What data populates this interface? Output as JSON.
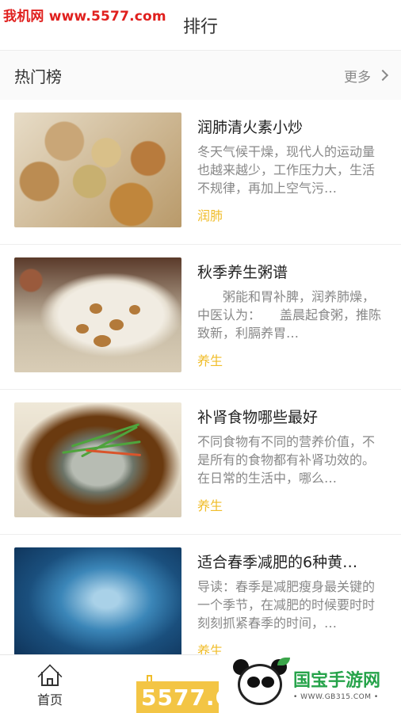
{
  "watermark_top": "我机网 www.5577.com",
  "header": {
    "title": "排行"
  },
  "section": {
    "title": "热门榜",
    "more_label": "更多"
  },
  "items": [
    {
      "title": "润肺清火素小炒",
      "desc": "冬天气候干燥，现代人的运动量也越来越少，工作压力大，生活不规律，再加上空气污…",
      "tag": "润肺"
    },
    {
      "title": "秋季养生粥谱",
      "desc": "　　粥能和胃补脾，润养肺燥，中医认为：　　盖晨起食粥，推陈致新，利膈养胃…",
      "tag": "养生"
    },
    {
      "title": "补肾食物哪些最好",
      "desc": "不同食物有不同的营养价值，不是所有的食物都有补肾功效的。在日常的生活中，哪么…",
      "tag": "养生"
    },
    {
      "title": "适合春季减肥的6种黄…",
      "desc": "导读：春季是减肥瘦身最关键的一个季节，在减肥的时候要时时刻刻抓紧春季的时间，…",
      "tag": "养生"
    }
  ],
  "tabbar": {
    "home_label": "首页"
  },
  "watermarks": {
    "site5577": "5577.C",
    "brand_name": "国宝手游网",
    "brand_url": "• WWW.GB315.COM •"
  },
  "colors": {
    "tag": "#f0bd2a",
    "watermark_red": "#e0201e",
    "brand_green": "#26a34a"
  }
}
